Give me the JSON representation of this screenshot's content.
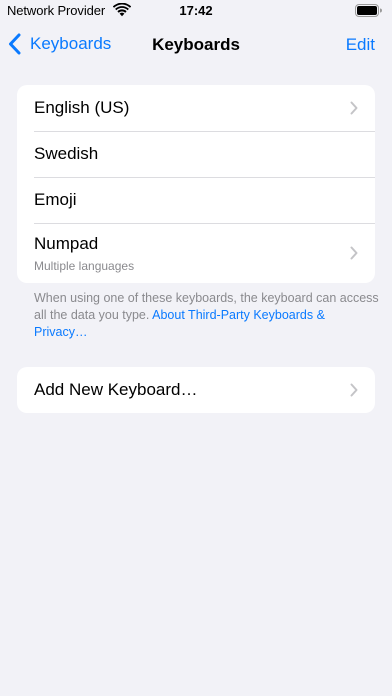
{
  "status_bar": {
    "carrier": "Network Provider",
    "time": "17:42",
    "wifi_icon": "wifi-icon",
    "battery_icon": "battery-icon"
  },
  "nav": {
    "back_label": "Keyboards",
    "title": "Keyboards",
    "edit_label": "Edit"
  },
  "keyboards": [
    {
      "label": "English (US)",
      "subtitle": "",
      "has_chevron": true
    },
    {
      "label": "Swedish",
      "subtitle": "",
      "has_chevron": false
    },
    {
      "label": "Emoji",
      "subtitle": "",
      "has_chevron": false
    },
    {
      "label": "Numpad",
      "subtitle": "Multiple languages",
      "has_chevron": true
    }
  ],
  "footer": {
    "text": "When using one of these keyboards, the keyboard can access all the data you type. ",
    "link": "About Third-Party Keyboards & Privacy…"
  },
  "add": {
    "label": "Add New Keyboard…"
  },
  "colors": {
    "accent": "#0a7aff",
    "background": "#f2f2f7",
    "secondary_text": "#8a8a8e",
    "chevron": "#c4c4c7"
  }
}
